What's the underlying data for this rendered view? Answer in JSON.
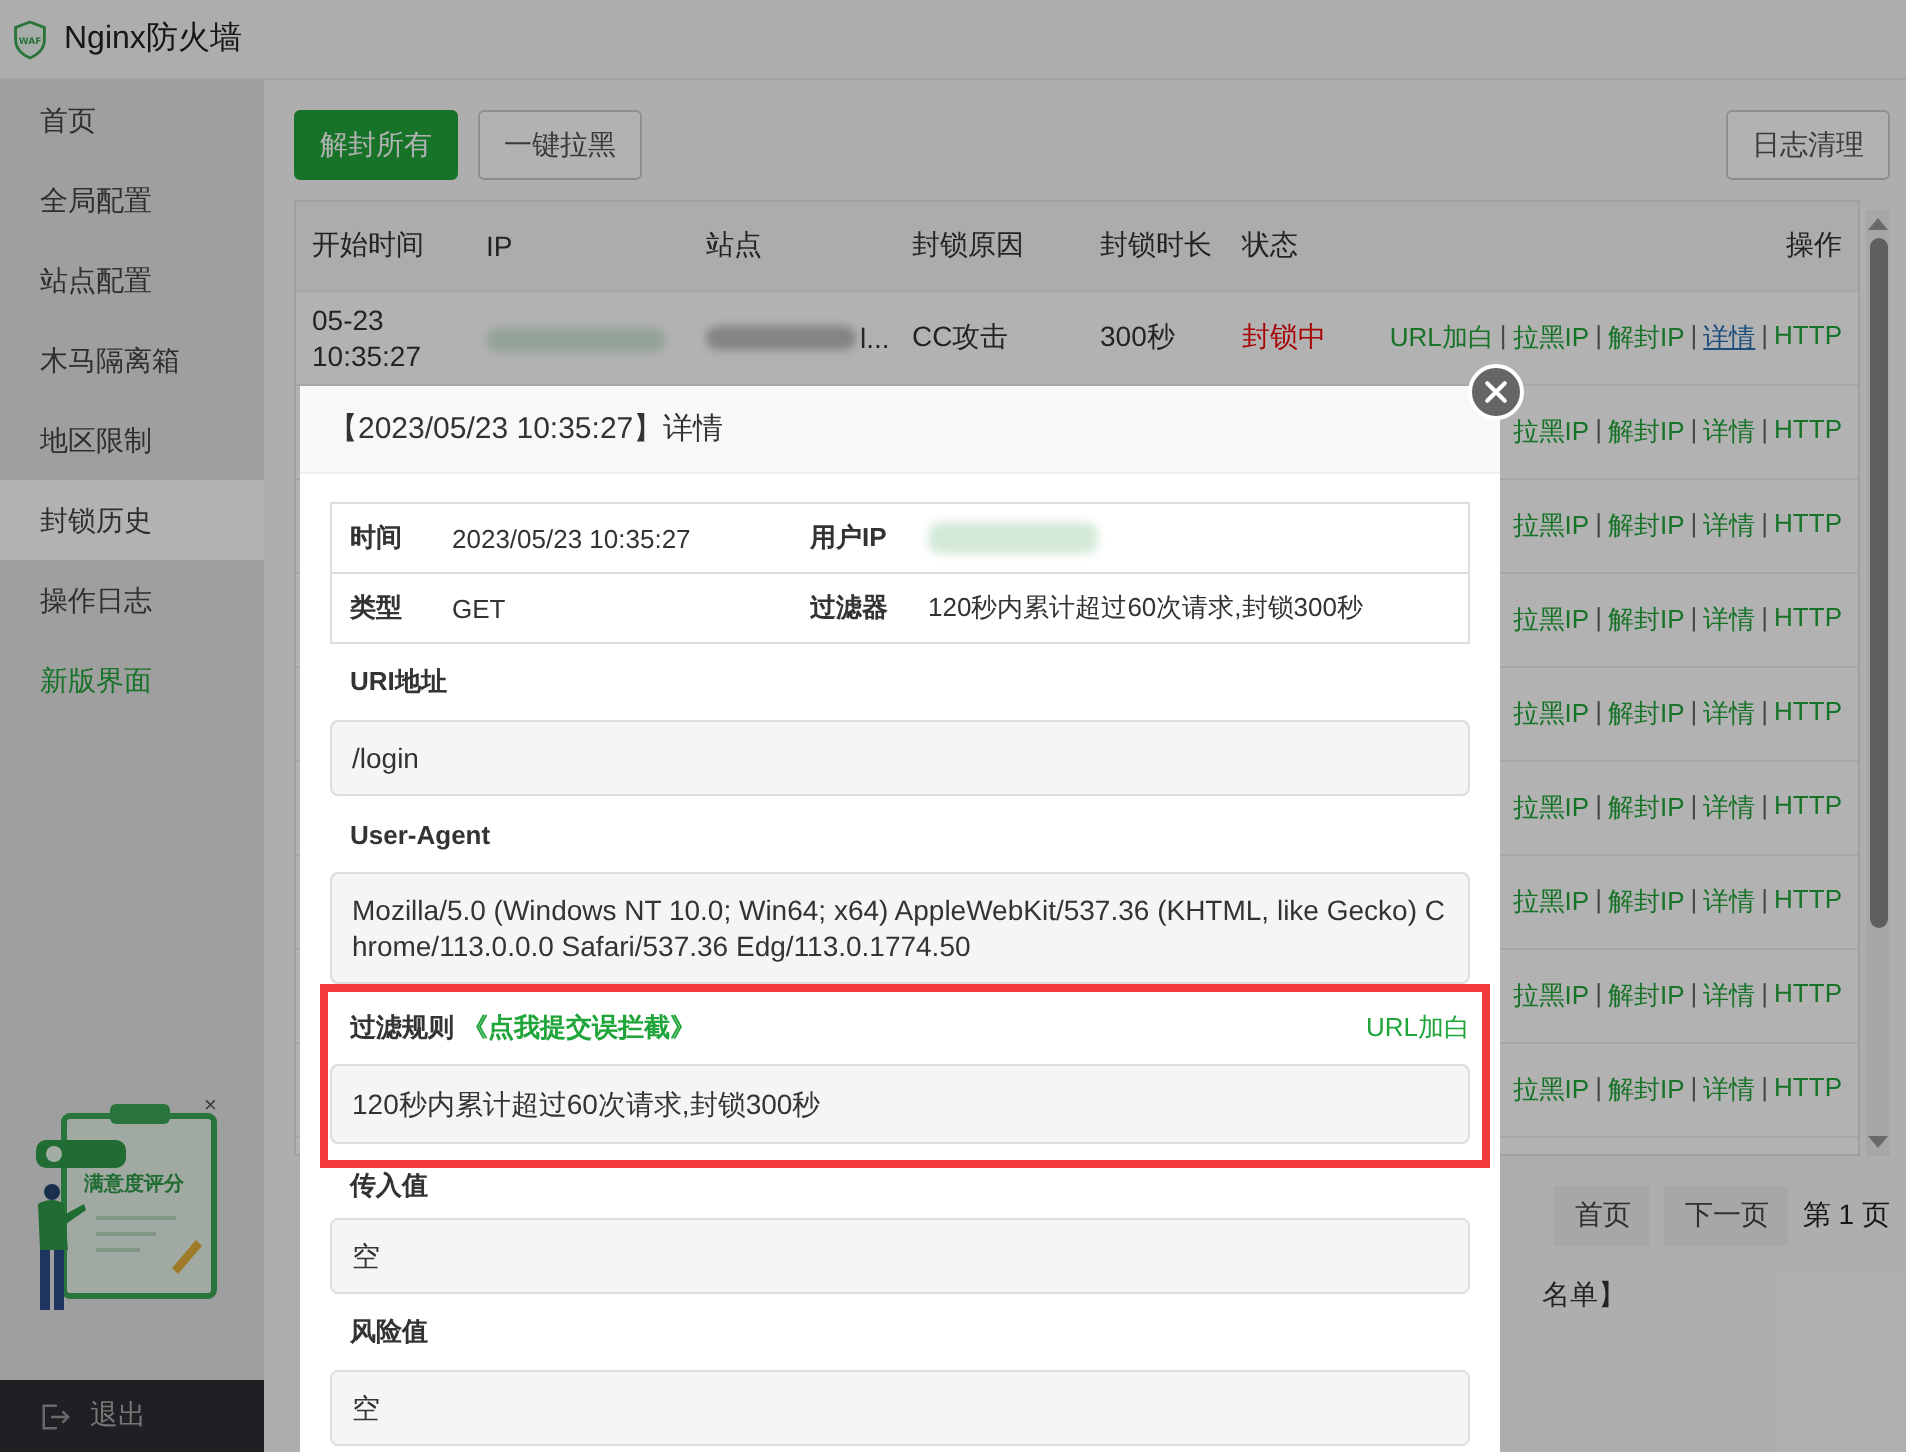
{
  "app": {
    "title": "Nginx防火墙",
    "logo_text": "WAF"
  },
  "sidebar": {
    "items": [
      {
        "label": "首页",
        "selected": false,
        "kind": "nav"
      },
      {
        "label": "全局配置",
        "selected": false,
        "kind": "nav"
      },
      {
        "label": "站点配置",
        "selected": false,
        "kind": "nav"
      },
      {
        "label": "木马隔离箱",
        "selected": false,
        "kind": "nav"
      },
      {
        "label": "地区限制",
        "selected": false,
        "kind": "nav"
      },
      {
        "label": "封锁历史",
        "selected": true,
        "kind": "nav"
      },
      {
        "label": "操作日志",
        "selected": false,
        "kind": "nav"
      },
      {
        "label": "新版界面",
        "selected": false,
        "kind": "promo"
      }
    ],
    "logout": "退出"
  },
  "feedback_widget": {
    "title": "满意度评分",
    "close": "×"
  },
  "toolbar": {
    "buttons": [
      {
        "label": "解封所有",
        "kind": "primary"
      },
      {
        "label": "一键拉黑",
        "kind": "default"
      }
    ],
    "right_button": "日志清理"
  },
  "table": {
    "columns": [
      "开始时间",
      "IP",
      "站点",
      "封锁原因",
      "封锁时长",
      "状态",
      "操作"
    ],
    "rows": [
      {
        "start_time": "05-23\n10:35:27",
        "ip_redacted": true,
        "site_visible": "l...",
        "reason": "CC攻击",
        "duration": "300秒",
        "status": "封锁中",
        "actions": [
          {
            "kind": "link",
            "label": "URL加白",
            "hovered": false
          },
          {
            "kind": "separator",
            "label": "|"
          },
          {
            "kind": "link",
            "label": "拉黑IP",
            "hovered": false
          },
          {
            "kind": "separator",
            "label": "|"
          },
          {
            "kind": "link",
            "label": "解封IP",
            "hovered": false
          },
          {
            "kind": "separator",
            "label": "|"
          },
          {
            "kind": "link",
            "label": "详情",
            "hovered": true
          },
          {
            "kind": "separator",
            "label": "|"
          },
          {
            "kind": "link",
            "label": "HTTP",
            "hovered": false
          }
        ]
      },
      {
        "actions": [
          {
            "kind": "link",
            "label": "拉黑IP",
            "hovered": false
          },
          {
            "kind": "separator",
            "label": "|"
          },
          {
            "kind": "link",
            "label": "解封IP",
            "hovered": false
          },
          {
            "kind": "separator",
            "label": "|"
          },
          {
            "kind": "link",
            "label": "详情",
            "hovered": false
          },
          {
            "kind": "separator",
            "label": "|"
          },
          {
            "kind": "link",
            "label": "HTTP",
            "hovered": false
          }
        ]
      },
      {
        "actions": [
          {
            "kind": "link",
            "label": "拉黑IP",
            "hovered": false
          },
          {
            "kind": "separator",
            "label": "|"
          },
          {
            "kind": "link",
            "label": "解封IP",
            "hovered": false
          },
          {
            "kind": "separator",
            "label": "|"
          },
          {
            "kind": "link",
            "label": "详情",
            "hovered": false
          },
          {
            "kind": "separator",
            "label": "|"
          },
          {
            "kind": "link",
            "label": "HTTP",
            "hovered": false
          }
        ]
      },
      {
        "actions": [
          {
            "kind": "link",
            "label": "拉黑IP",
            "hovered": false
          },
          {
            "kind": "separator",
            "label": "|"
          },
          {
            "kind": "link",
            "label": "解封IP",
            "hovered": false
          },
          {
            "kind": "separator",
            "label": "|"
          },
          {
            "kind": "link",
            "label": "详情",
            "hovered": false
          },
          {
            "kind": "separator",
            "label": "|"
          },
          {
            "kind": "link",
            "label": "HTTP",
            "hovered": false
          }
        ]
      },
      {
        "actions": [
          {
            "kind": "link",
            "label": "拉黑IP",
            "hovered": false
          },
          {
            "kind": "separator",
            "label": "|"
          },
          {
            "kind": "link",
            "label": "解封IP",
            "hovered": false
          },
          {
            "kind": "separator",
            "label": "|"
          },
          {
            "kind": "link",
            "label": "详情",
            "hovered": false
          },
          {
            "kind": "separator",
            "label": "|"
          },
          {
            "kind": "link",
            "label": "HTTP",
            "hovered": false
          }
        ]
      },
      {
        "actions": [
          {
            "kind": "link",
            "label": "拉黑IP",
            "hovered": false
          },
          {
            "kind": "separator",
            "label": "|"
          },
          {
            "kind": "link",
            "label": "解封IP",
            "hovered": false
          },
          {
            "kind": "separator",
            "label": "|"
          },
          {
            "kind": "link",
            "label": "详情",
            "hovered": false
          },
          {
            "kind": "separator",
            "label": "|"
          },
          {
            "kind": "link",
            "label": "HTTP",
            "hovered": false
          }
        ]
      },
      {
        "actions": [
          {
            "kind": "link",
            "label": "拉黑IP",
            "hovered": false
          },
          {
            "kind": "separator",
            "label": "|"
          },
          {
            "kind": "link",
            "label": "解封IP",
            "hovered": false
          },
          {
            "kind": "separator",
            "label": "|"
          },
          {
            "kind": "link",
            "label": "详情",
            "hovered": false
          },
          {
            "kind": "separator",
            "label": "|"
          },
          {
            "kind": "link",
            "label": "HTTP",
            "hovered": false
          }
        ]
      },
      {
        "actions": [
          {
            "kind": "link",
            "label": "拉黑IP",
            "hovered": false
          },
          {
            "kind": "separator",
            "label": "|"
          },
          {
            "kind": "link",
            "label": "解封IP",
            "hovered": false
          },
          {
            "kind": "separator",
            "label": "|"
          },
          {
            "kind": "link",
            "label": "详情",
            "hovered": false
          },
          {
            "kind": "separator",
            "label": "|"
          },
          {
            "kind": "link",
            "label": "HTTP",
            "hovered": false
          }
        ]
      },
      {
        "actions": [
          {
            "kind": "link",
            "label": "拉黑IP",
            "hovered": false
          },
          {
            "kind": "separator",
            "label": "|"
          },
          {
            "kind": "link",
            "label": "解封IP",
            "hovered": false
          },
          {
            "kind": "separator",
            "label": "|"
          },
          {
            "kind": "link",
            "label": "详情",
            "hovered": false
          },
          {
            "kind": "separator",
            "label": "|"
          },
          {
            "kind": "link",
            "label": "HTTP",
            "hovered": false
          }
        ]
      }
    ]
  },
  "pagination": {
    "buttons": [
      "首页",
      "下一页"
    ],
    "page_label": "第 1 页"
  },
  "note_fragment": "名单】",
  "detail_modal": {
    "title": "【2023/05/23 10:35:27】详情",
    "info": [
      {
        "label": "时间",
        "value": "2023/05/23 10:35:27",
        "redacted": false
      },
      {
        "label": "用户IP",
        "redacted": true
      },
      {
        "label": "类型",
        "value": "GET",
        "redacted": false
      },
      {
        "label": "过滤器",
        "value": "120秒内累计超过60次请求,封锁300秒",
        "redacted": false
      }
    ],
    "sections": [
      {
        "kind": "field",
        "label": "URI地址",
        "value": "/login"
      },
      {
        "kind": "field",
        "label": "User-Agent",
        "value": "Mozilla/5.0 (Windows NT 10.0; Win64; x64) AppleWebKit/537.36 (KHTML, like Gecko) Chrome/113.0.0.0 Safari/537.36 Edg/113.0.1774.50"
      },
      {
        "kind": "rule",
        "label": "过滤规则",
        "link": "《点我提交误拦截》",
        "action": "URL加白",
        "value": "120秒内累计超过60次请求,封锁300秒",
        "highlighted": true
      },
      {
        "kind": "field",
        "label": "传入值",
        "value": "空"
      },
      {
        "kind": "field",
        "label": "风险值",
        "value": "空"
      }
    ]
  }
}
